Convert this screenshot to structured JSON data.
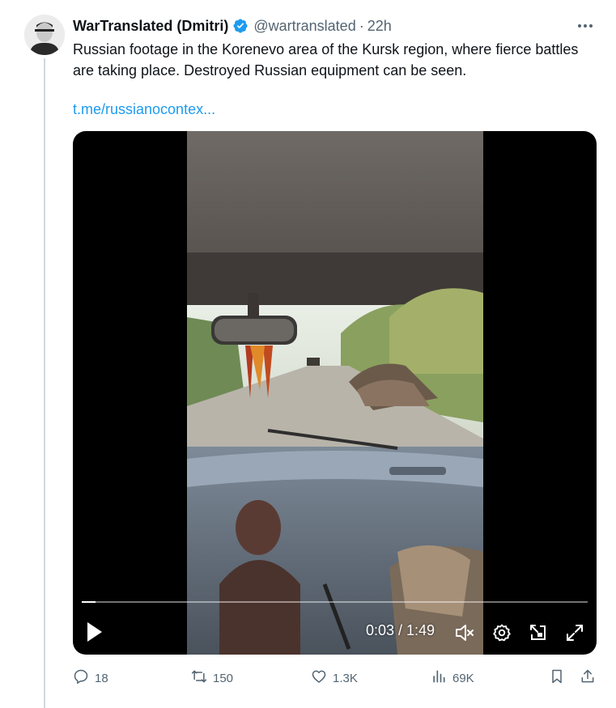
{
  "post": {
    "author_name": "WarTranslated (Dmitri)",
    "handle": "@wartranslated",
    "separator": "·",
    "time": "22h",
    "text": "Russian footage in the Korenevo area of the Kursk region, where fierce battles are taking place. Destroyed Russian equipment can be seen.",
    "link_text": "t.me/russianocontex...",
    "verified_icon": "verified-badge-icon",
    "accent_color": "#1d9bf0"
  },
  "video": {
    "elapsed": "0:03",
    "duration": "1:49",
    "time_display": "0:03 / 1:49",
    "progress_fraction": 0.0275,
    "controls": [
      "play-icon",
      "mute-icon",
      "settings-icon",
      "pip-icon",
      "fullscreen-icon"
    ]
  },
  "actions": {
    "replies": "18",
    "reposts": "150",
    "likes": "1.3K",
    "views": "69K"
  }
}
